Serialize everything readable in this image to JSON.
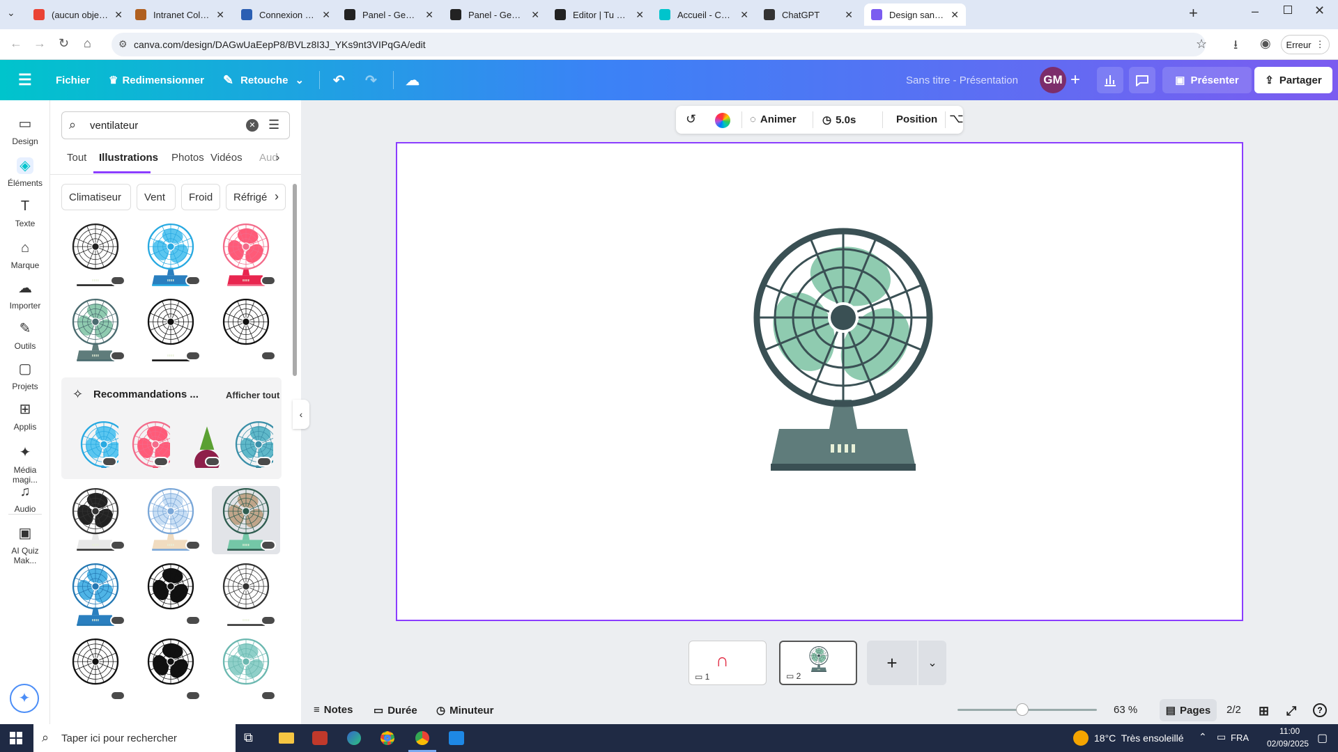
{
  "browser": {
    "tabs": [
      {
        "label": "(aucun objet) - gauth",
        "fav": "gmail-icon",
        "color": "#ea4335"
      },
      {
        "label": "Intranet College Saint",
        "fav": "page-icon",
        "color": "#b06020"
      },
      {
        "label": "Connexion - EcoleDir",
        "fav": "link-icon",
        "color": "#2b5fb3"
      },
      {
        "label": "Panel - Genially",
        "fav": "genially-icon",
        "color": "#222"
      },
      {
        "label": "Panel - Genially",
        "fav": "genially-icon",
        "color": "#222"
      },
      {
        "label": "Editor | Tu as trouvé",
        "fav": "genially-icon",
        "color": "#222"
      },
      {
        "label": "Accueil - Canva",
        "fav": "canva-icon",
        "color": "#00c4cc"
      },
      {
        "label": "ChatGPT",
        "fav": "chatgpt-icon",
        "color": "#333"
      },
      {
        "label": "Design sans titre - Pr",
        "fav": "canva-icon",
        "color": "#7b5cf0"
      }
    ],
    "url": "canva.com/design/DAGwUaEepP8/BVLz8I3J_YKs9nt3VIPqGA/edit",
    "profile_label": "Erreur"
  },
  "canva": {
    "menu": {
      "file": "Fichier",
      "resize": "Redimensionner",
      "retouch": "Retouche"
    },
    "doc_title": "Sans titre - Présentation",
    "avatar_initials": "GM",
    "present": "Présenter",
    "share": "Partager",
    "rail": [
      {
        "label": "Design",
        "icon": "design-icon"
      },
      {
        "label": "Éléments",
        "icon": "elements-icon"
      },
      {
        "label": "Texte",
        "icon": "text-icon"
      },
      {
        "label": "Marque",
        "icon": "brand-icon"
      },
      {
        "label": "Importer",
        "icon": "upload-icon"
      },
      {
        "label": "Outils",
        "icon": "tools-icon"
      },
      {
        "label": "Projets",
        "icon": "folder-icon"
      },
      {
        "label": "Applis",
        "icon": "apps-icon"
      },
      {
        "label": "Média magi...",
        "icon": "magic-media-icon"
      },
      {
        "label": "Audio",
        "icon": "audio-icon"
      },
      {
        "label": "AI Quiz Mak...",
        "icon": "quiz-icon"
      }
    ],
    "search_value": "ventilateur",
    "panel_tabs": [
      "Tout",
      "Illustrations",
      "Photos",
      "Vidéos",
      "Aud"
    ],
    "chips": [
      "Climatiseur",
      "Vent",
      "Froid",
      "Réfrigé"
    ],
    "reco_title": "Recommandations ...",
    "reco_link": "Afficher tout",
    "toolbar": {
      "animate": "Animer",
      "duration": "5.0s",
      "position": "Position"
    },
    "pages": [
      {
        "comments": "1"
      },
      {
        "comments": "2"
      }
    ],
    "bottom": {
      "notes": "Notes",
      "duration": "Durée",
      "timer": "Minuteur",
      "zoom": "63 %",
      "pages_label": "Pages",
      "page_count": "2/2"
    }
  },
  "taskbar": {
    "search_placeholder": "Taper ici pour rechercher",
    "weather": "18°C  Très ensoleillé",
    "lang": "FRA",
    "time": "11:00",
    "date": "02/09/2025"
  },
  "colors": {
    "accent": "#8b3dff",
    "fan_dark": "#3a5054",
    "fan_mint": "#8fcbb0",
    "fan_base": "#5f7c7b"
  }
}
